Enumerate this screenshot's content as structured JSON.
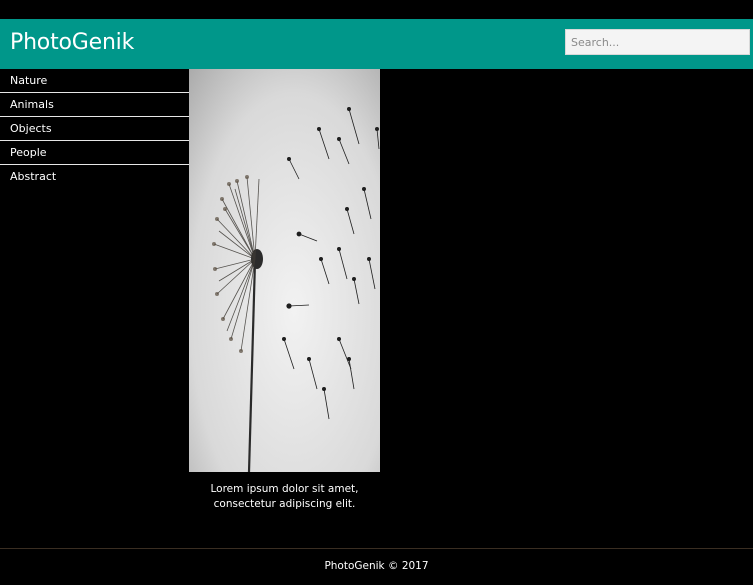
{
  "header": {
    "brand": "PhotoGenik",
    "search_placeholder": "Search..."
  },
  "sidebar": {
    "items": [
      {
        "label": "Nature"
      },
      {
        "label": "Animals"
      },
      {
        "label": "Objects"
      },
      {
        "label": "People"
      },
      {
        "label": "Abstract"
      }
    ]
  },
  "gallery": {
    "caption_line1": "Lorem ipsum dolor sit amet,",
    "caption_line2": "consectetur adipiscing elit."
  },
  "footer": {
    "text": "PhotoGenik © 2017"
  },
  "colors": {
    "header": "#00978a",
    "background": "#000000"
  }
}
